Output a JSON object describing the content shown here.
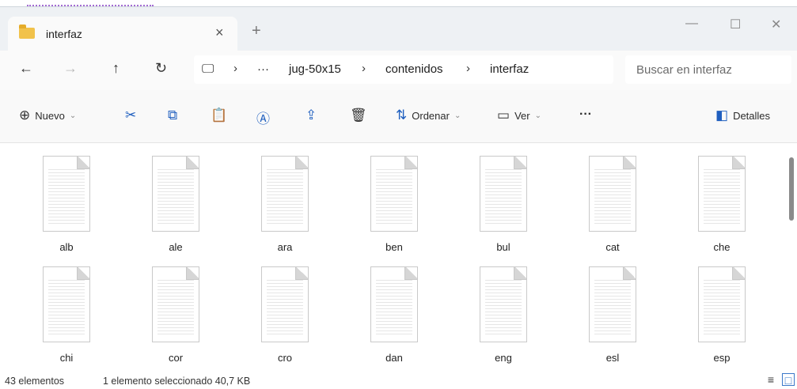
{
  "tab": {
    "title": "interfaz"
  },
  "breadcrumb": [
    {
      "label": "jug-50x15"
    },
    {
      "label": "contenidos"
    },
    {
      "label": "interfaz"
    }
  ],
  "breadcrumb_ellipsis": "···",
  "search": {
    "placeholder": "Buscar en interfaz"
  },
  "toolbar": {
    "new_label": "Nuevo",
    "sort_label": "Ordenar",
    "view_label": "Ver",
    "more_label": "···",
    "details_label": "Detalles"
  },
  "files": [
    {
      "name": "alb"
    },
    {
      "name": "ale"
    },
    {
      "name": "ara"
    },
    {
      "name": "ben"
    },
    {
      "name": "bul"
    },
    {
      "name": "cat"
    },
    {
      "name": "che"
    },
    {
      "name": "chi"
    },
    {
      "name": "cor"
    },
    {
      "name": "cro"
    },
    {
      "name": "dan"
    },
    {
      "name": "eng"
    },
    {
      "name": "esl"
    },
    {
      "name": "esp"
    }
  ],
  "status": {
    "count": "43 elementos",
    "selected": "1 elemento seleccionado  40,7 KB"
  },
  "colors": {
    "accent": "#1f5fbf",
    "folder": "#f1c24b"
  }
}
